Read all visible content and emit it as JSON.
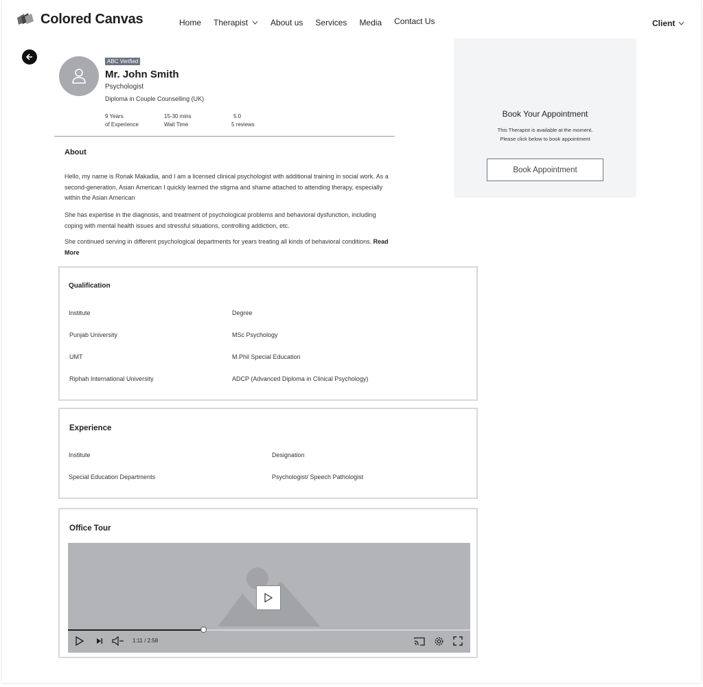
{
  "header": {
    "brand": "Colored Canvas",
    "nav": [
      {
        "label": "Home"
      },
      {
        "label": "Therapist"
      },
      {
        "label": "About us"
      },
      {
        "label": "Services"
      },
      {
        "label": "Media"
      },
      {
        "label": "Contact Us"
      }
    ],
    "client_label": "Client"
  },
  "profile": {
    "badge": "ABC Verified",
    "name": "Mr. John Smith",
    "role": "Psychologist",
    "diploma": "Diploma in Couple Counselling (UK)",
    "stats": [
      {
        "value": "9 Years",
        "label": "of Experience"
      },
      {
        "value": "15-30 mins",
        "label": "Wait Time"
      },
      {
        "value": "5.0",
        "label": "5 reviews"
      }
    ]
  },
  "about": {
    "heading": "About",
    "paragraphs": [
      "Hello, my name is Ronak Makadia, and I am a licensed clinical psychologist with additional training in social work. As a second-generation, Asian American I quickly learned the stigma and shame attached to attending therapy, especially within the Asian American",
      "She has expertise in the diagnosis, and treatment of psychological problems and behavioral dysfunction, including coping with mental health issues and stressful situations, controlling addiction, etc.",
      "She continued serving in different psychological departments for years treating all kinds of behavioral conditions."
    ],
    "read_more": "Read More"
  },
  "booking": {
    "title": "Book Your Appointment",
    "line1": "This Therapist is available at the moment.",
    "line2": "Please click below to book appointment",
    "button": "Book Appointment"
  },
  "qualification": {
    "heading": "Qualification",
    "col1": "Institute",
    "col2": "Degree",
    "rows": [
      {
        "institute": "Punjab University",
        "degree": "MSc Psychology"
      },
      {
        "institute": "UMT",
        "degree": "M.Phil Special Education"
      },
      {
        "institute": "Riphah International University",
        "degree": "ADCP (Advanced Diploma in Clinical Psychology)"
      }
    ]
  },
  "experience": {
    "heading": "Experience",
    "col1": "Institute",
    "col2": "Designation",
    "rows": [
      {
        "institute": "Special Education Departments",
        "designation": "Psychologist/ Speech Pathologist"
      }
    ]
  },
  "office_tour": {
    "heading": "Office Tour",
    "time": "1:11 / 2:58",
    "progress": 0.336
  },
  "icons": {
    "back": "arrow-left-icon",
    "avatar": "user-icon",
    "play": "play-icon",
    "next": "skip-next-icon",
    "volume": "volume-muted-icon",
    "cast": "cast-icon",
    "settings": "gear-icon",
    "fullscreen": "fullscreen-icon"
  }
}
